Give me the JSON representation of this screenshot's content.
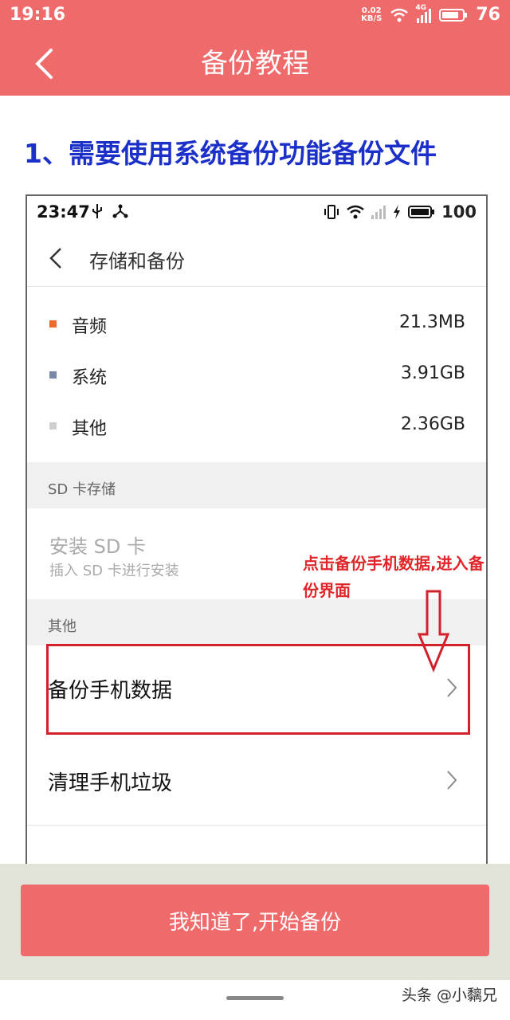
{
  "status": {
    "time": "19:16",
    "speed_top": "0.02",
    "speed_bottom": "KB/S",
    "net": "4G",
    "battery": "76"
  },
  "header": {
    "title": "备份教程"
  },
  "step": {
    "title": "1、需要使用系统备份功能备份文件"
  },
  "screenshot": {
    "status": {
      "time": "23:47",
      "battery": "100"
    },
    "nav_title": "存储和备份",
    "storage": [
      {
        "label": "音频",
        "value": "21.3MB",
        "color": "#f06a2f"
      },
      {
        "label": "系统",
        "value": "3.91GB",
        "color": "#7a8aa6"
      },
      {
        "label": "其他",
        "value": "2.36GB",
        "color": "#cfcfcf"
      }
    ],
    "sd_section": "SD 卡存储",
    "sd_title": "安装 SD 卡",
    "sd_sub": "插入 SD 卡进行安装",
    "other_section": "其他",
    "items": [
      {
        "label": "备份手机数据"
      },
      {
        "label": "清理手机垃圾"
      }
    ],
    "annotation": "点击备份手机数据,进入备份界面"
  },
  "cta": {
    "label": "我知道了,开始备份"
  },
  "watermark": "头条 @小黐兄"
}
